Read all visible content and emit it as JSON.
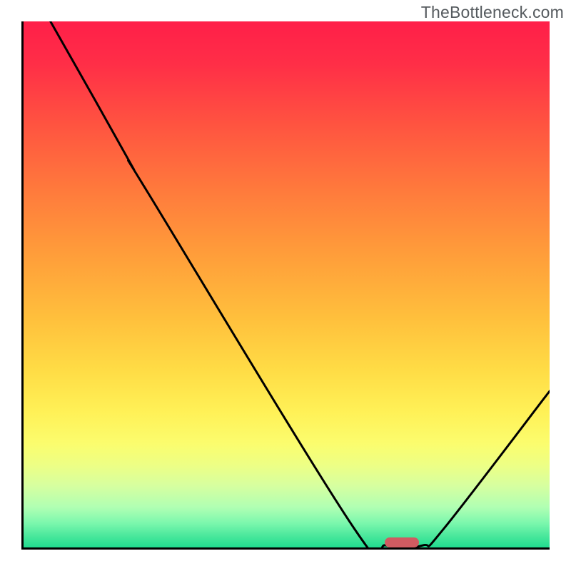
{
  "watermark": "TheBottleneck.com",
  "chart_data": {
    "type": "line",
    "title": "",
    "xlabel": "",
    "ylabel": "",
    "xlim": [
      0,
      100
    ],
    "ylim": [
      0,
      100
    ],
    "background_gradient": {
      "top_color": "#ff1f49",
      "mid_color": "#ffdc45",
      "bottom_color": "#19d98d",
      "meaning": "red=high bottleneck, green=low bottleneck"
    },
    "curve_points": [
      {
        "x": 5.5,
        "y": 100
      },
      {
        "x": 14,
        "y": 85
      },
      {
        "x": 21,
        "y": 72.5
      },
      {
        "x": 24,
        "y": 67.5
      },
      {
        "x": 63,
        "y": 4
      },
      {
        "x": 69,
        "y": 0.8
      },
      {
        "x": 76,
        "y": 0.8
      },
      {
        "x": 80,
        "y": 4
      },
      {
        "x": 100,
        "y": 30
      }
    ],
    "optimal_marker": {
      "x": 72,
      "y": 1.3,
      "color": "#cf5b61",
      "shape": "rounded-bar"
    },
    "annotations": [],
    "legend": [],
    "note": "No axis tick labels visible; values are normalised 0-100 estimates read from geometry."
  }
}
